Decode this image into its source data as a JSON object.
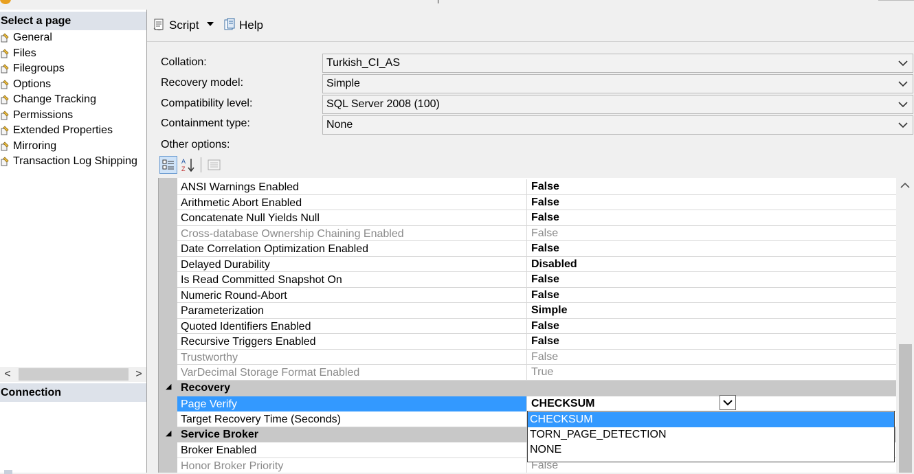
{
  "left_panel": {
    "select_header": "Select a page",
    "pages": [
      {
        "label": "General"
      },
      {
        "label": "Files"
      },
      {
        "label": "Filegroups"
      },
      {
        "label": "Options"
      },
      {
        "label": "Change Tracking"
      },
      {
        "label": "Permissions"
      },
      {
        "label": "Extended Properties"
      },
      {
        "label": "Mirroring"
      },
      {
        "label": "Transaction Log Shipping"
      }
    ],
    "scroll_left": "<",
    "scroll_right": ">",
    "connection_header": "Connection"
  },
  "toolbar": {
    "script_label": "Script",
    "help_label": "Help"
  },
  "form": {
    "collation_label": "Collation:",
    "collation_value": "Turkish_CI_AS",
    "recovery_model_label": "Recovery model:",
    "recovery_model_value": "Simple",
    "compat_label": "Compatibility level:",
    "compat_value": "SQL Server 2008 (100)",
    "containment_label": "Containment type:",
    "containment_value": "None",
    "other_options_label": "Other options:"
  },
  "grid": {
    "rows": [
      {
        "name": "ANSI Warnings Enabled",
        "value": "False"
      },
      {
        "name": "Arithmetic Abort Enabled",
        "value": "False"
      },
      {
        "name": "Concatenate Null Yields Null",
        "value": "False"
      },
      {
        "name": "Cross-database Ownership Chaining Enabled",
        "value": "False"
      },
      {
        "name": "Date Correlation Optimization Enabled",
        "value": "False"
      },
      {
        "name": "Delayed Durability",
        "value": "Disabled"
      },
      {
        "name": "Is Read Committed Snapshot On",
        "value": "False"
      },
      {
        "name": "Numeric Round-Abort",
        "value": "False"
      },
      {
        "name": "Parameterization",
        "value": "Simple"
      },
      {
        "name": "Quoted Identifiers Enabled",
        "value": "False"
      },
      {
        "name": "Recursive Triggers Enabled",
        "value": "False"
      },
      {
        "name": "Trustworthy",
        "value": "False"
      },
      {
        "name": "VarDecimal Storage Format Enabled",
        "value": "True"
      }
    ],
    "recovery_category": "Recovery",
    "page_verify": {
      "name": "Page Verify",
      "value": "CHECKSUM"
    },
    "target_recovery": {
      "name": "Target Recovery Time (Seconds)"
    },
    "service_broker_category": "Service Broker",
    "broker_enabled": {
      "name": "Broker Enabled"
    },
    "honor_priority": {
      "name": "Honor Broker Priority",
      "value": "False"
    },
    "dropdown_options": [
      "CHECKSUM",
      "TORN_PAGE_DETECTION",
      "NONE"
    ],
    "selected_option": "CHECKSUM"
  },
  "colors": {
    "selection": "#3399ff",
    "header_bg": "#dde2ea",
    "grid_margin": "#c8c8c8",
    "disabled_text": "#8a8a8a"
  },
  "icons": {
    "page": "page-icon",
    "script": "script-icon",
    "help": "help-icon",
    "categorized": "categorized-icon",
    "alphabetical": "alphabetical-sort-icon",
    "property_pages": "property-pages-icon"
  }
}
